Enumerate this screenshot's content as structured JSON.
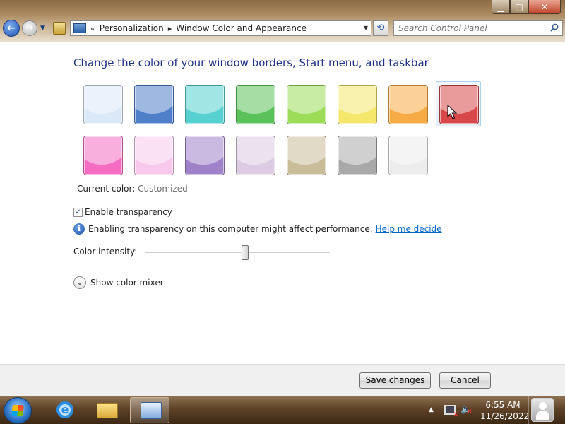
{
  "window": {
    "buttons": {
      "minimize": "▁",
      "maximize": "□",
      "close": "✕"
    }
  },
  "navigation": {
    "back_glyph": "←",
    "forward_glyph": "→",
    "recent_glyph": "▼",
    "address": {
      "overflow": "«",
      "crumbs": [
        "Personalization",
        "Window Color and Appearance"
      ],
      "separator": "▸",
      "dropdown_glyph": "▼"
    },
    "refresh_glyph": "⟲",
    "search": {
      "placeholder": "Search Control Panel"
    }
  },
  "content": {
    "title": "Change the color of your window borders, Start menu, and taskbar",
    "swatches": [
      {
        "name": "sky",
        "color": "#dbe8f7"
      },
      {
        "name": "twilight",
        "color": "#4f7fc8"
      },
      {
        "name": "sea",
        "color": "#57d0d0"
      },
      {
        "name": "leaf",
        "color": "#5bc25b"
      },
      {
        "name": "lime",
        "color": "#9cdc58"
      },
      {
        "name": "lemon",
        "color": "#f5e66c"
      },
      {
        "name": "pumpkin",
        "color": "#f7ab45"
      },
      {
        "name": "ruby",
        "color": "#d8474a",
        "selected": true
      },
      {
        "name": "fuchsia",
        "color": "#f56dc2"
      },
      {
        "name": "blush",
        "color": "#f8c8ec"
      },
      {
        "name": "violet",
        "color": "#9f82c9"
      },
      {
        "name": "lavender",
        "color": "#dccbe2"
      },
      {
        "name": "taupe",
        "color": "#c9bc99"
      },
      {
        "name": "chocolate",
        "color": "#a9a9a9"
      },
      {
        "name": "frost",
        "color": "#ececec"
      }
    ],
    "current_color_label": "Current color:",
    "current_color_value": "Customized",
    "transparency": {
      "label": "Enable transparency",
      "checked": true,
      "check_glyph": "✓"
    },
    "info_glyph": "i",
    "info_text": "Enabling transparency on this computer might affect performance.",
    "help_link": "Help me decide",
    "intensity": {
      "label": "Color intensity:",
      "value": 0.54
    },
    "mixer": {
      "glyph": "⌄",
      "label": "Show color mixer"
    }
  },
  "footer": {
    "save_label": "Save changes",
    "cancel_label": "Cancel"
  },
  "taskbar": {
    "items": [
      "internet-explorer",
      "windows-explorer",
      "control-panel"
    ],
    "ie_glyph": "e",
    "tray_arrow": "▲",
    "volume_glyph": "🔈",
    "volume_muted_glyph": "✕",
    "time": "6:55 AM",
    "date": "11/26/2022"
  }
}
